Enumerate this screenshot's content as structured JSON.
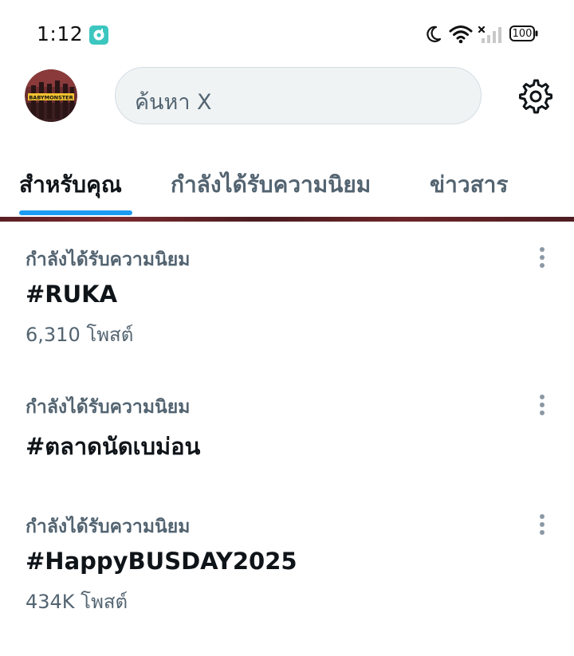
{
  "status_bar": {
    "time": "1:12",
    "app_icon": "music-app-icon",
    "battery": "100",
    "icons": [
      "moon-icon",
      "wifi-icon",
      "no-signal-icon",
      "battery-icon"
    ]
  },
  "header": {
    "avatar_text": "BABYMONSTER",
    "search_placeholder": "ค้นหา X",
    "settings_icon": "gear-icon"
  },
  "tabs": [
    {
      "label": "สำหรับคุณ",
      "active": true
    },
    {
      "label": "กำลังได้รับความนิยม",
      "active": false
    },
    {
      "label": "ข่าวสาร",
      "active": false
    }
  ],
  "trends": [
    {
      "context": "กำลังได้รับความนิยม",
      "name": "#RUKA",
      "count": "6,310 โพสต์"
    },
    {
      "context": "กำลังได้รับความนิยม",
      "name": "#ตลาดนัดเบม่อน",
      "count": ""
    },
    {
      "context": "กำลังได้รับความนิยม",
      "name": "#HappyBUSDAY2025",
      "count": "434K โพสต์"
    }
  ],
  "colors": {
    "accent": "#1d9bf0",
    "text_primary": "#0f1419",
    "text_secondary": "#536471",
    "search_bg": "#eff3f4",
    "app_icon": "#3cc6c0"
  }
}
